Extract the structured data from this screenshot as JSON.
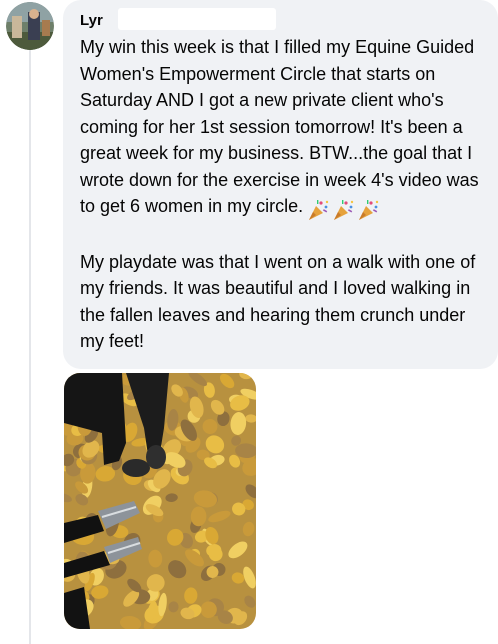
{
  "post": {
    "author_partial": "Lyr",
    "paragraph_1": "My win this week is that I filled my Equine Guided Women's Empowerment Circle that starts on Saturday AND I got a new private client who's coming for her 1st session tomorrow! It's been a great week for my business. BTW...the goal that I wrote down for the exercise in week 4's video was to get 6 women in my circle.",
    "paragraph_1_emojis": [
      "party-popper-emoji",
      "party-popper-emoji",
      "party-popper-emoji"
    ],
    "paragraph_2": "My playdate was that I went on a walk with one of my friends. It was beautiful and I loved walking in the fallen leaves and hearing them crunch under my feet!"
  },
  "colors": {
    "bubble_bg": "#f0f2f5",
    "text": "#050505",
    "thread_line": "#e4e6ea",
    "leaf_yellow": "#e3b43a",
    "leaf_brown": "#9a7a4a"
  },
  "icons": {
    "avatar": "profile-photo-avatar",
    "attachment": "fallen-leaves-photo"
  }
}
